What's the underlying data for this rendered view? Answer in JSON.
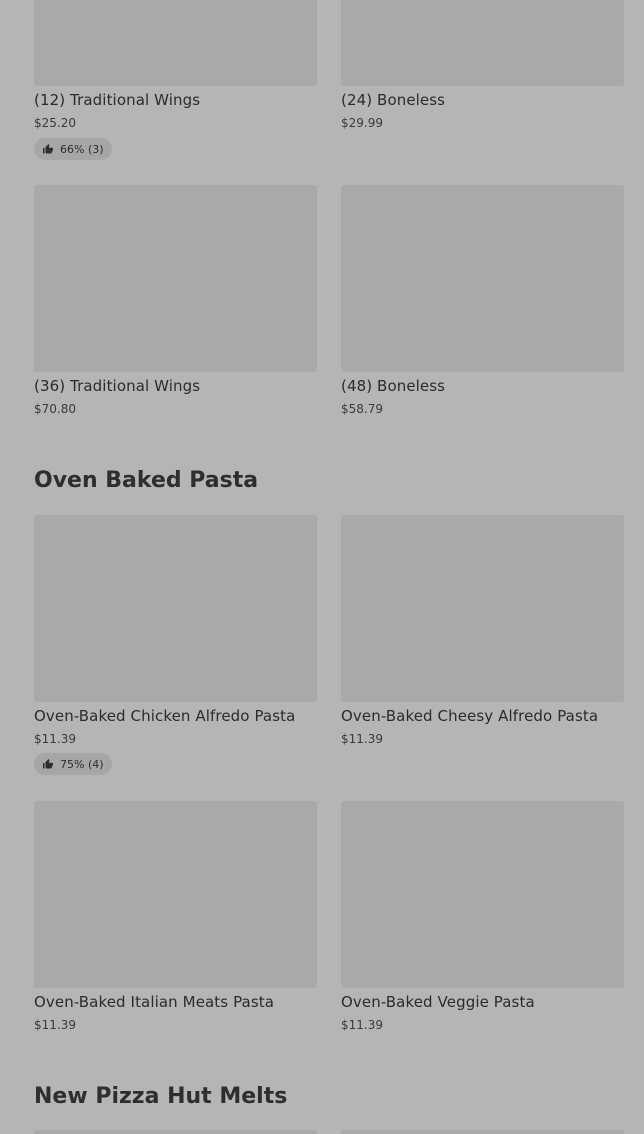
{
  "wings_section": {
    "items": [
      {
        "name": "(12) Traditional Wings",
        "price": "$25.20",
        "rating": "66% (3)"
      },
      {
        "name": "(24) Boneless",
        "price": "$29.99"
      },
      {
        "name": "(36) Traditional Wings",
        "price": "$70.80"
      },
      {
        "name": "(48) Boneless",
        "price": "$58.79"
      }
    ]
  },
  "pasta_section": {
    "title": "Oven Baked Pasta",
    "items": [
      {
        "name": "Oven-Baked Chicken Alfredo Pasta",
        "price": "$11.39",
        "rating": "75% (4)"
      },
      {
        "name": "Oven-Baked Cheesy Alfredo Pasta",
        "price": "$11.39"
      },
      {
        "name": "Oven-Baked Italian Meats Pasta",
        "price": "$11.39"
      },
      {
        "name": "Oven-Baked Veggie Pasta",
        "price": "$11.39"
      }
    ]
  },
  "melts_section": {
    "title": "New Pizza Hut Melts"
  },
  "icons": {
    "rating": "thumbs-up-icon"
  },
  "colors": {
    "background": "#b5b5b5",
    "image_placeholder": "#a9a9a9",
    "rating_pill": "#a6a6a6",
    "text": "#2b2b2b"
  }
}
